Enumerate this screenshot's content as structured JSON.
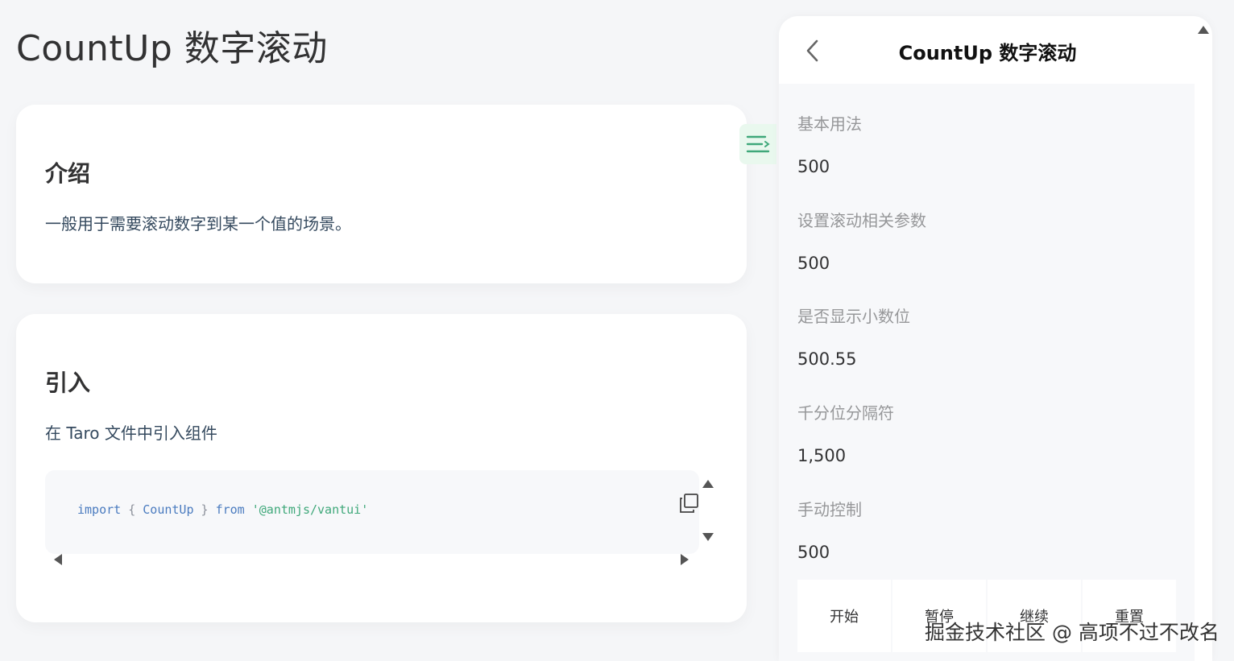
{
  "page": {
    "title": "CountUp 数字滚动"
  },
  "intro": {
    "heading": "介绍",
    "text": "一般用于需要滚动数字到某一个值的场景。"
  },
  "import": {
    "heading": "引入",
    "text": "在 Taro 文件中引入组件",
    "code": {
      "kw_import": "import",
      "brace_open": "{",
      "identifier": "CountUp",
      "brace_close": "}",
      "kw_from": "from",
      "source": "'@antmjs/vantui'"
    }
  },
  "icons": {
    "copy": "copy-icon",
    "toc": "menu-icon",
    "back": "chevron-left-icon"
  },
  "colors": {
    "accent": "#3fa87a",
    "toc_bg": "#e9f8ee"
  },
  "demo": {
    "title": "CountUp 数字滚动",
    "sections": [
      {
        "title": "基本用法",
        "value": "500"
      },
      {
        "title": "设置滚动相关参数",
        "value": "500"
      },
      {
        "title": "是否显示小数位",
        "value": "500.55"
      },
      {
        "title": "千分位分隔符",
        "value": "1,500"
      },
      {
        "title": "手动控制",
        "value": "500"
      }
    ],
    "buttons": [
      "开始",
      "暂停",
      "继续",
      "重置"
    ]
  },
  "watermark": "掘金技术社区 @ 高项不过不改名"
}
